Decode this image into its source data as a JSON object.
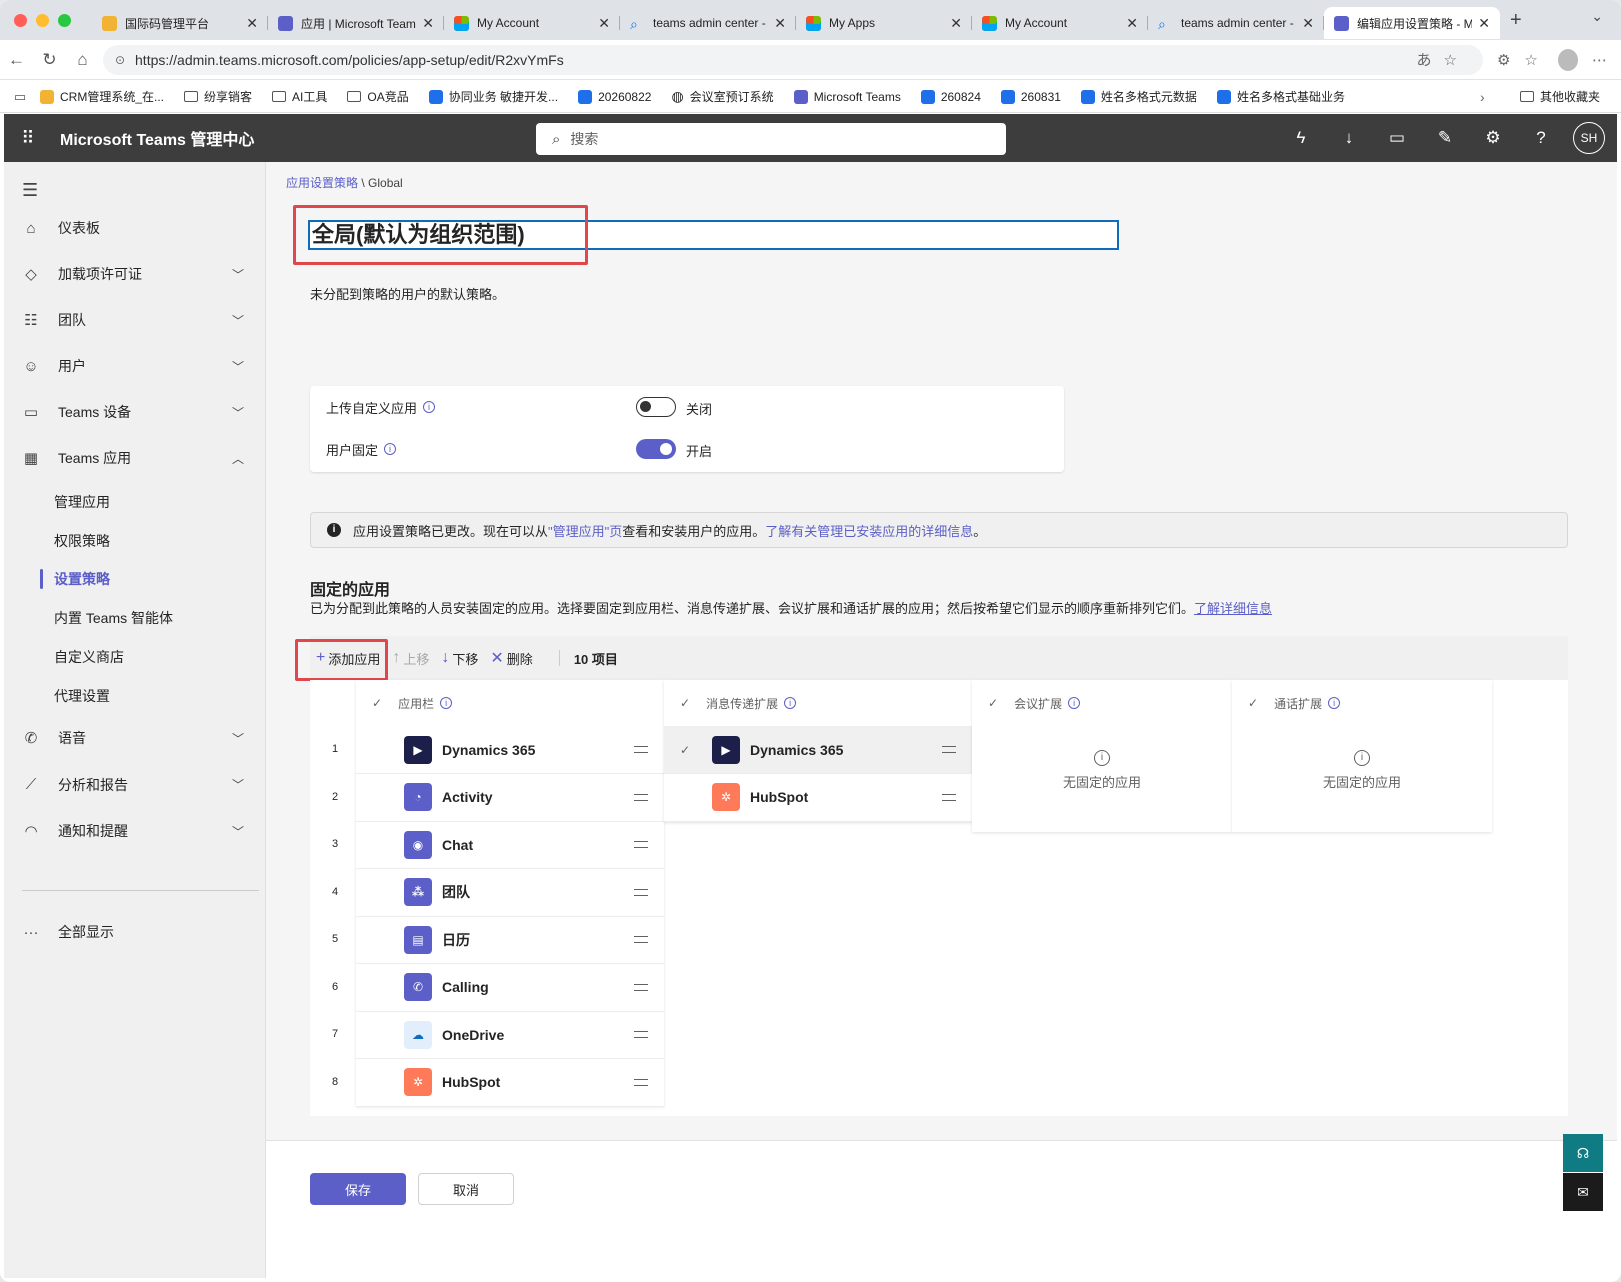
{
  "browser": {
    "tabs": [
      {
        "title": "国际码管理平台",
        "fav": "#f2b233"
      },
      {
        "title": "应用 | Microsoft Team",
        "fav": "#5b5fc7"
      },
      {
        "title": "My Account",
        "fav": "ms"
      },
      {
        "title": "teams admin center -",
        "fav": "search"
      },
      {
        "title": "My Apps",
        "fav": "ms"
      },
      {
        "title": "My Account",
        "fav": "ms"
      },
      {
        "title": "teams admin center -",
        "fav": "search"
      },
      {
        "title": "编辑应用设置策略 - M",
        "fav": "#5b5fc7",
        "active": true
      }
    ],
    "url": "https://admin.teams.microsoft.com/policies/app-setup/edit/R2xvYmFs",
    "bookmarks": [
      {
        "label": "CRM管理系统_在...",
        "icon": "#f2b233"
      },
      {
        "label": "纷享销客",
        "icon": "folder"
      },
      {
        "label": "AI工具",
        "icon": "folder"
      },
      {
        "label": "OA竞品",
        "icon": "folder"
      },
      {
        "label": "协同业务 敏捷开发...",
        "icon": "#1f6feb"
      },
      {
        "label": "20260822",
        "icon": "#1f6feb"
      },
      {
        "label": "会议室预订系统",
        "icon": "globe"
      },
      {
        "label": "Microsoft Teams",
        "icon": "#5b5fc7"
      },
      {
        "label": "260824",
        "icon": "#1f6feb"
      },
      {
        "label": "260831",
        "icon": "#1f6feb"
      },
      {
        "label": "姓名多格式元数据",
        "icon": "#1f6feb"
      },
      {
        "label": "姓名多格式基础业务",
        "icon": "#1f6feb"
      }
    ],
    "other_bookmarks": "其他收藏夹"
  },
  "header": {
    "title": "Microsoft Teams 管理中心",
    "search_placeholder": "搜索",
    "user_initials": "SH"
  },
  "sidebar": {
    "items": [
      {
        "label": "仪表板",
        "icon": "home-icon",
        "glyph": "⌂"
      },
      {
        "label": "加载项许可证",
        "icon": "diamond-icon",
        "glyph": "◇",
        "chevron": "down"
      },
      {
        "label": "团队",
        "icon": "teams-icon",
        "glyph": "☷",
        "chevron": "down"
      },
      {
        "label": "用户",
        "icon": "users-icon",
        "glyph": "☺",
        "chevron": "down"
      },
      {
        "label": "Teams 设备",
        "icon": "devices-icon",
        "glyph": "▭",
        "chevron": "down"
      },
      {
        "label": "Teams 应用",
        "icon": "apps-icon",
        "glyph": "▦",
        "chevron": "up"
      }
    ],
    "subitems": [
      {
        "label": "管理应用"
      },
      {
        "label": "权限策略"
      },
      {
        "label": "设置策略",
        "active": true
      },
      {
        "label": "内置 Teams 智能体"
      },
      {
        "label": "自定义商店"
      },
      {
        "label": "代理设置"
      }
    ],
    "lower_items": [
      {
        "label": "语音",
        "icon": "phone-icon",
        "glyph": "✆"
      },
      {
        "label": "分析和报告",
        "icon": "chart-icon",
        "glyph": "⟋"
      },
      {
        "label": "通知和提醒",
        "icon": "bell-icon",
        "glyph": "◠"
      }
    ],
    "show_all": "全部显示"
  },
  "main": {
    "breadcrumb_link": "应用设置策略",
    "breadcrumb_sep": " \\ ",
    "breadcrumb_current": "Global",
    "policy_name": "全局(默认为组织范围)",
    "policy_description": "未分配到策略的用户的默认策略。",
    "settings": [
      {
        "label": "上传自定义应用",
        "state": "关闭",
        "on": false
      },
      {
        "label": "用户固定",
        "state": "开启",
        "on": true
      }
    ],
    "banner": {
      "text_before": "应用设置策略已更改。现在可以从",
      "link1": "\"管理应用\"页",
      "text_mid": "查看和安装用户的应用。",
      "link2": "了解有关管理已安装应用的详细信息",
      "text_after": "。"
    },
    "pinned": {
      "title": "固定的应用",
      "description": "已为分配到此策略的人员安装固定的应用。选择要固定到应用栏、消息传递扩展、会议扩展和通话扩展的应用；然后按希望它们显示的顺序重新排列它们。",
      "learn_more": "了解详细信息"
    },
    "toolbar": {
      "add": "添加应用",
      "up": "上移",
      "down": "下移",
      "delete": "删除",
      "count": "10 项目"
    },
    "columns": {
      "app_bar": "应用栏",
      "messaging": "消息传递扩展",
      "meeting": "会议扩展",
      "calling": "通话扩展"
    },
    "app_bar_apps": [
      {
        "num": "1",
        "name": "Dynamics 365",
        "color": "#1c1f4a",
        "glyph": "▶"
      },
      {
        "num": "2",
        "name": "Activity",
        "color": "#5b5fc7",
        "glyph": "◔"
      },
      {
        "num": "3",
        "name": "Chat",
        "color": "#5b5fc7",
        "glyph": "◉"
      },
      {
        "num": "4",
        "name": "团队",
        "color": "#5b5fc7",
        "glyph": "⁂"
      },
      {
        "num": "5",
        "name": "日历",
        "color": "#5b5fc7",
        "glyph": "▤"
      },
      {
        "num": "6",
        "name": "Calling",
        "color": "#5b5fc7",
        "glyph": "✆"
      },
      {
        "num": "7",
        "name": "OneDrive",
        "color": "#e3eefc",
        "glyph": "☁"
      },
      {
        "num": "8",
        "name": "HubSpot",
        "color": "#ff7a59",
        "glyph": "✲"
      }
    ],
    "messaging_apps": [
      {
        "name": "Dynamics 365",
        "color": "#1c1f4a",
        "glyph": "▶",
        "selected": true
      },
      {
        "name": "HubSpot",
        "color": "#ff7a59",
        "glyph": "✲"
      }
    ],
    "no_pinned": "无固定的应用",
    "save": "保存",
    "cancel": "取消"
  }
}
